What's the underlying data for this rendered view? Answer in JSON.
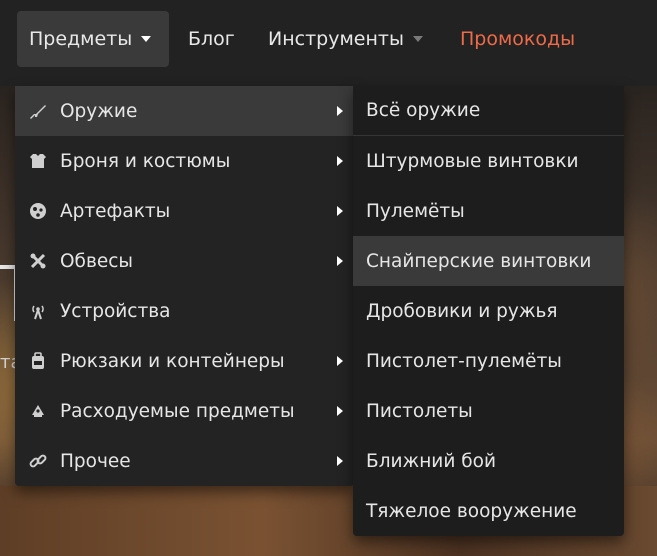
{
  "navbar": {
    "items": [
      {
        "label": "Предметы",
        "has_caret": true,
        "active": true
      },
      {
        "label": "Блог"
      },
      {
        "label": "Инструменты",
        "has_caret": true
      },
      {
        "label": "Промокоды",
        "color": "#ee6a48"
      }
    ]
  },
  "background": {
    "letter_fragment": "та"
  },
  "categories_menu": {
    "items": [
      {
        "label": "Оружие",
        "icon": "rifle-icon",
        "active": true
      },
      {
        "label": "Броня и костюмы",
        "icon": "armor-icon"
      },
      {
        "label": "Артефакты",
        "icon": "artifact-icon"
      },
      {
        "label": "Обвесы",
        "icon": "tools-icon"
      },
      {
        "label": "Устройства",
        "icon": "antenna-icon"
      },
      {
        "label": "Рюкзаки и контейнеры",
        "icon": "backpack-icon"
      },
      {
        "label": "Расходуемые предметы",
        "icon": "consumables-icon"
      },
      {
        "label": "Прочее",
        "icon": "link-icon"
      }
    ]
  },
  "weapons_submenu": {
    "items": [
      {
        "label": "Всё оружие"
      },
      {
        "label": "Штурмовые винтовки"
      },
      {
        "label": "Пулемёты"
      },
      {
        "label": "Снайперские винтовки",
        "hover": true
      },
      {
        "label": "Дробовики и ружья"
      },
      {
        "label": "Пистолет-пулемёты"
      },
      {
        "label": "Пистолеты"
      },
      {
        "label": "Ближний бой"
      },
      {
        "label": "Тяжелое вооружение"
      }
    ]
  },
  "colors": {
    "navbar_bg": "#222222",
    "active_bg": "#3a3a3a",
    "promo": "#ee6a48"
  }
}
